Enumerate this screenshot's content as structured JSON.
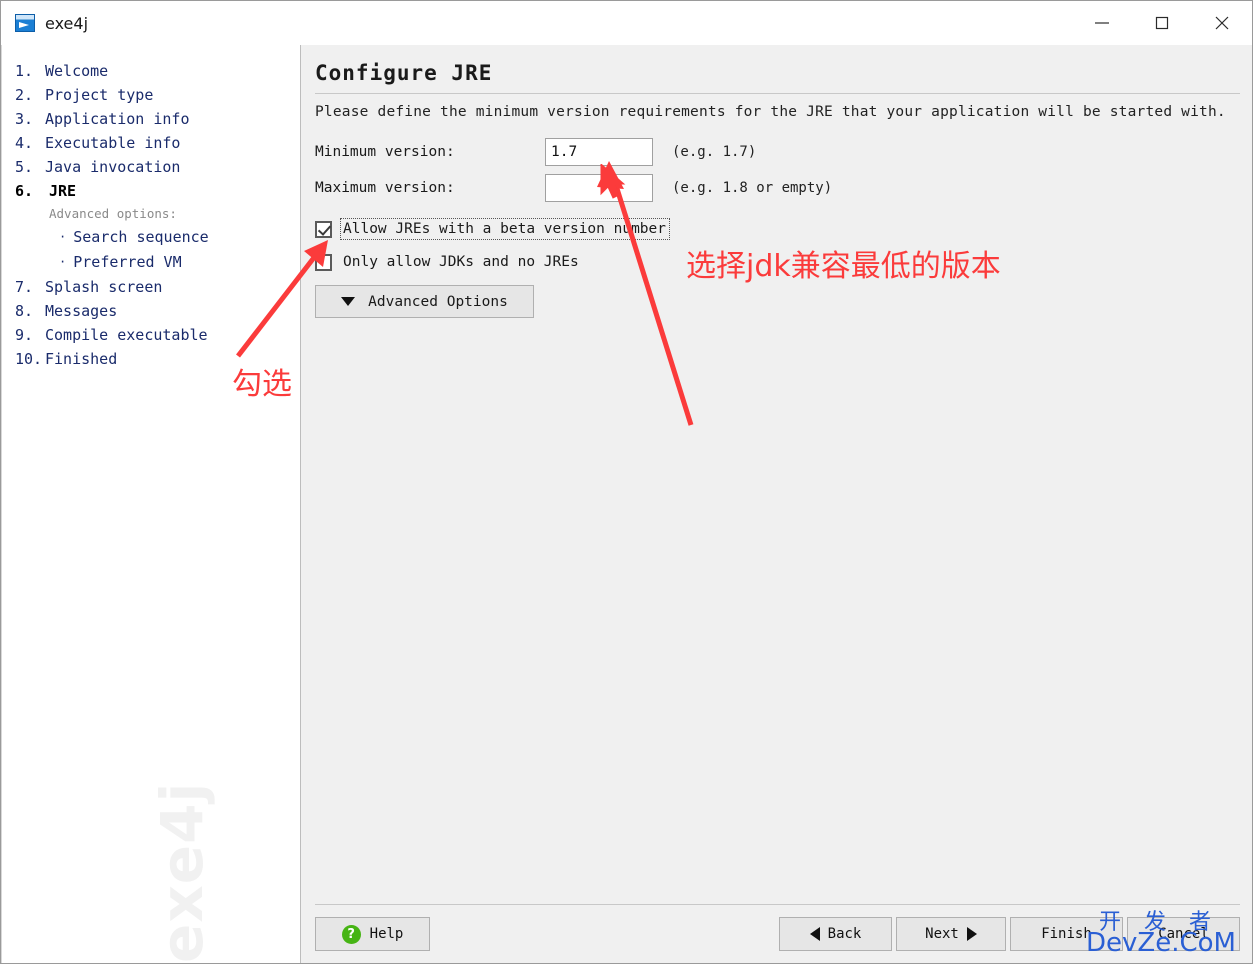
{
  "window": {
    "title": "exe4j",
    "icon": "app-window-rocket-icon",
    "controls": {
      "minimize": "minimize-icon",
      "maximize": "maximize-icon",
      "close": "close-icon"
    }
  },
  "sidebar": {
    "watermark": "exe4j",
    "items": [
      {
        "num": "1.",
        "label": "Welcome",
        "current": false
      },
      {
        "num": "2.",
        "label": "Project type",
        "current": false
      },
      {
        "num": "3.",
        "label": "Application info",
        "current": false
      },
      {
        "num": "4.",
        "label": "Executable info",
        "current": false
      },
      {
        "num": "5.",
        "label": "Java invocation",
        "current": false
      },
      {
        "num": "6.",
        "label": "JRE",
        "current": true
      }
    ],
    "advanced_heading": "Advanced options:",
    "sub_items": [
      {
        "bullet": "·",
        "label": "Search sequence"
      },
      {
        "bullet": "·",
        "label": "Preferred VM"
      }
    ],
    "items_after": [
      {
        "num": "7.",
        "label": "Splash screen",
        "current": false
      },
      {
        "num": "8.",
        "label": "Messages",
        "current": false
      },
      {
        "num": "9.",
        "label": "Compile executable",
        "current": false
      },
      {
        "num": "10.",
        "label": "Finished",
        "current": false
      }
    ]
  },
  "main": {
    "title": "Configure JRE",
    "intro": "Please define the minimum version requirements for the JRE that your application will be started with.",
    "fields": [
      {
        "label": "Minimum version:",
        "value": "1.7",
        "placeholder": "",
        "hint": "(e.g. 1.7)"
      },
      {
        "label": "Maximum version:",
        "value": "",
        "placeholder": "",
        "hint": "(e.g. 1.8 or empty)"
      }
    ],
    "checkboxes": [
      {
        "label": "Allow JREs with a beta version number",
        "checked": true,
        "focused": true
      },
      {
        "label": "Only allow JDKs and no JREs",
        "checked": false,
        "focused": false
      }
    ],
    "advanced_button": {
      "label": "Advanced Options",
      "icon": "chevron-down-icon"
    }
  },
  "footer": {
    "help": {
      "label": "Help",
      "icon": "help-circle-icon"
    },
    "back": {
      "label": "Back",
      "icon": "triangle-left-icon"
    },
    "next": {
      "label": "Next",
      "icon": "triangle-right-icon"
    },
    "finish": {
      "label": "Finish"
    },
    "cancel": {
      "label": "Cancel"
    }
  },
  "annotations": [
    {
      "text": "选择jdk兼容最低的版本",
      "color": "#fb3b3b"
    },
    {
      "text": "勾选",
      "color": "#fb3b3b"
    }
  ],
  "watermark": {
    "cn": "开 发 者",
    "en": "DevZe.CoM",
    "color": "#2a5fd4"
  }
}
